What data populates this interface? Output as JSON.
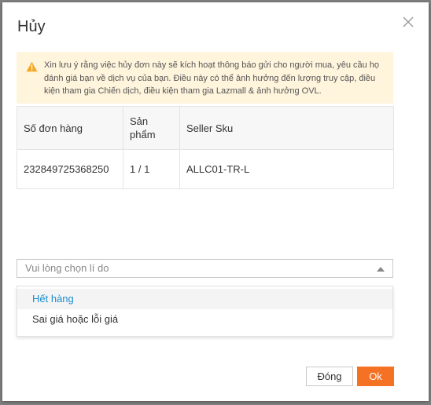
{
  "dialog": {
    "title": "Hủy",
    "notice": "Xin lưu ý rằng việc hủy đơn này sẽ kích hoạt thông báo gửi cho người mua, yêu cầu họ đánh giá bạn về dịch vụ của bạn. Điều này có thể ảnh hưởng đến lượng truy cập, điều kiện tham gia Chiến dịch, điều kiện tham gia Lazmall & ảnh hưởng OVL.",
    "table": {
      "headers": [
        "Số đơn hàng",
        "Sản phẩm",
        "Seller Sku"
      ],
      "rows": [
        [
          "232849725368250",
          "1 / 1",
          "ALLC01-TR-L"
        ]
      ]
    },
    "reason_select": {
      "placeholder": "Vui lòng chọn lí do",
      "options": [
        "Hết hàng",
        "Sai giá hoặc lỗi giá"
      ]
    },
    "buttons": {
      "cancel": "Đóng",
      "ok": "Ok"
    }
  },
  "icons": {
    "close": "close-icon",
    "warning": "warning-icon",
    "caret": "caret-up-icon"
  },
  "colors": {
    "accent": "#f57224",
    "link": "#1b8ed0",
    "notice_bg": "#fff4dc",
    "warning_icon": "#f5a623"
  }
}
